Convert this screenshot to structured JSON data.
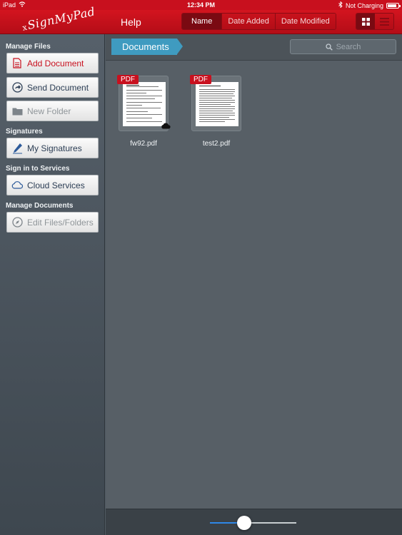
{
  "status_bar": {
    "device": "iPad",
    "time": "12:34 PM",
    "charging": "Not Charging",
    "battery_level": 0.85
  },
  "header": {
    "logo": "SignMyPad",
    "help_label": "Help",
    "sort_options": [
      "Name",
      "Date Added",
      "Date Modified"
    ],
    "active_sort": "Name",
    "view_modes": [
      "grid-icon",
      "list-icon"
    ],
    "active_view": "grid"
  },
  "sidebar": {
    "sections": [
      {
        "title": "Manage Files",
        "items": [
          {
            "label": "Add Document",
            "icon": "add-document-icon"
          },
          {
            "label": "Send Document",
            "icon": "send-icon"
          },
          {
            "label": "New Folder",
            "icon": "folder-icon"
          }
        ]
      },
      {
        "title": "Signatures",
        "items": [
          {
            "label": "My Signatures",
            "icon": "pen-icon"
          }
        ]
      },
      {
        "title": "Sign in to Services",
        "items": [
          {
            "label": "Cloud Services",
            "icon": "cloud-icon"
          }
        ]
      },
      {
        "title": "Manage Documents",
        "items": [
          {
            "label": "Edit Files/Folders",
            "icon": "compass-icon"
          }
        ]
      }
    ]
  },
  "main": {
    "breadcrumb": "Documents",
    "search_placeholder": "Search",
    "documents": [
      {
        "badge": "PDF",
        "name": "fw92.pdf",
        "cloud_synced": true
      },
      {
        "badge": "PDF",
        "name": "test2.pdf",
        "cloud_synced": false
      }
    ]
  },
  "zoom_slider": {
    "value": 0.4
  },
  "colors": {
    "brand_red": "#c8101e",
    "breadcrumb_blue": "#3f9bc0",
    "slider_blue": "#2f88e8"
  }
}
